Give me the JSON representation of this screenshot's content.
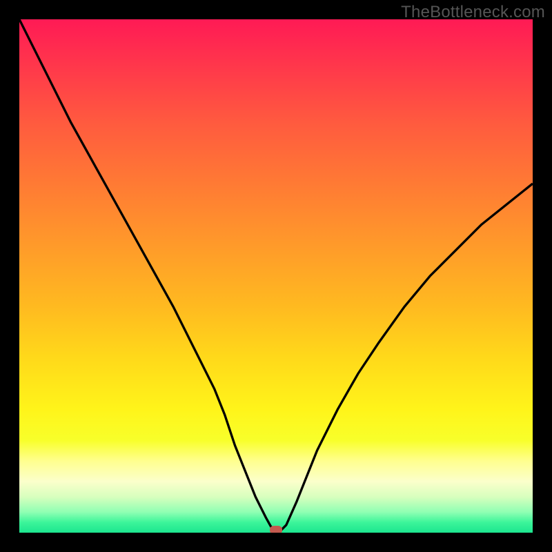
{
  "watermark": "TheBottleneck.com",
  "colors": {
    "frame_bg": "#000000",
    "curve": "#000000",
    "marker": "#c45a4f",
    "gradient_stops": [
      "#ff1a55",
      "#ff3a4a",
      "#ff5a3f",
      "#ff7a34",
      "#ff9a2a",
      "#ffba20",
      "#ffd91a",
      "#fff41a",
      "#f8ff2a",
      "#ffff8e",
      "#fbffcb",
      "#d8ffbe",
      "#8fffb3",
      "#3cf59a",
      "#1ce58f"
    ]
  },
  "chart_data": {
    "type": "line",
    "title": "",
    "xlabel": "",
    "ylabel": "",
    "xlim": [
      0,
      100
    ],
    "ylim": [
      0,
      100
    ],
    "series": [
      {
        "name": "curve",
        "x": [
          0,
          5,
          10,
          15,
          20,
          25,
          30,
          35,
          38,
          40,
          42,
          44,
          46,
          48,
          49,
          50,
          51,
          52,
          54,
          56,
          58,
          62,
          66,
          70,
          75,
          80,
          85,
          90,
          95,
          100
        ],
        "y": [
          100,
          90,
          80,
          71,
          62,
          53,
          44,
          34,
          28,
          23,
          17,
          12,
          7,
          3,
          1.2,
          0.5,
          0.5,
          1.5,
          6,
          11,
          16,
          24,
          31,
          37,
          44,
          50,
          55,
          60,
          64,
          68
        ]
      }
    ],
    "marker": {
      "x": 50,
      "y": 0.5
    },
    "annotations": []
  }
}
